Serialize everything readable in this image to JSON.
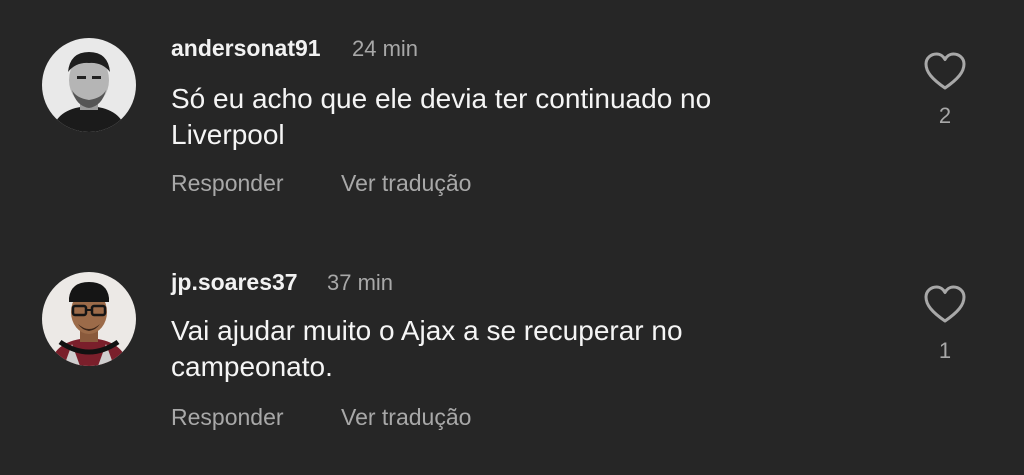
{
  "comments": [
    {
      "username": "andersonat91",
      "time": "24 min",
      "text_line1": "Só eu acho que ele devia ter continuado no",
      "text_line2": "Liverpool",
      "reply_label": "Responder",
      "translate_label": "Ver tradução",
      "like_icon": "heart-outline-icon",
      "likes": "2"
    },
    {
      "username": "jp.soares37",
      "time": "37 min",
      "text_line1": "Vai ajudar muito o Ajax a se recuperar no",
      "text_line2": "campeonato.",
      "reply_label": "Responder",
      "translate_label": "Ver tradução",
      "like_icon": "heart-outline-icon",
      "likes": "1"
    }
  ],
  "colors": {
    "background": "#262626",
    "primary_text": "#f5f5f5",
    "secondary_text": "#a8a8a8"
  }
}
